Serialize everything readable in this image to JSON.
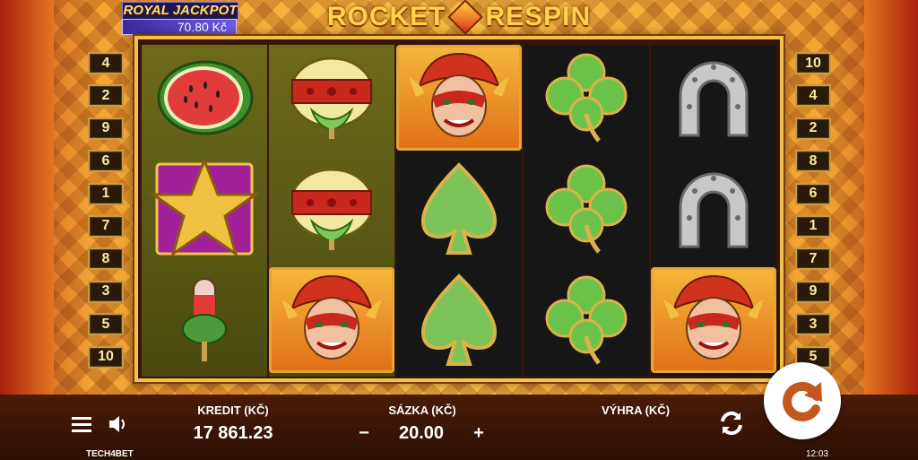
{
  "game": {
    "title_left": "ROCKET",
    "title_right": "RESPIN",
    "jackpot_label": "ROYAL JACKPOT",
    "jackpot_value": "70.80 Kč"
  },
  "paylines": {
    "left": [
      "4",
      "2",
      "9",
      "6",
      "1",
      "7",
      "8",
      "3",
      "5",
      "10"
    ],
    "right": [
      "10",
      "4",
      "2",
      "8",
      "6",
      "1",
      "7",
      "9",
      "3",
      "5"
    ]
  },
  "reels": [
    [
      "watermelon",
      "star",
      "popsicle"
    ],
    [
      "rocket-pop",
      "rocket-pop",
      "jester"
    ],
    [
      "jester",
      "spade",
      "spade"
    ],
    [
      "clover",
      "clover",
      "clover"
    ],
    [
      "horseshoe",
      "horseshoe",
      "jester"
    ]
  ],
  "bottom_bar": {
    "credit_label": "KREDIT (KČ)",
    "credit_value": "17 861.23",
    "bet_label": "SÁZKA (KČ)",
    "bet_value": "20.00",
    "bet_minus": "−",
    "bet_plus": "+",
    "win_label": "VÝHRA (KČ)",
    "win_value": "",
    "brand": "TECH4BET",
    "clock": "12:03"
  },
  "colors": {
    "accent_gold": "#f2c14a",
    "bar_bg": "#2d0f03"
  }
}
